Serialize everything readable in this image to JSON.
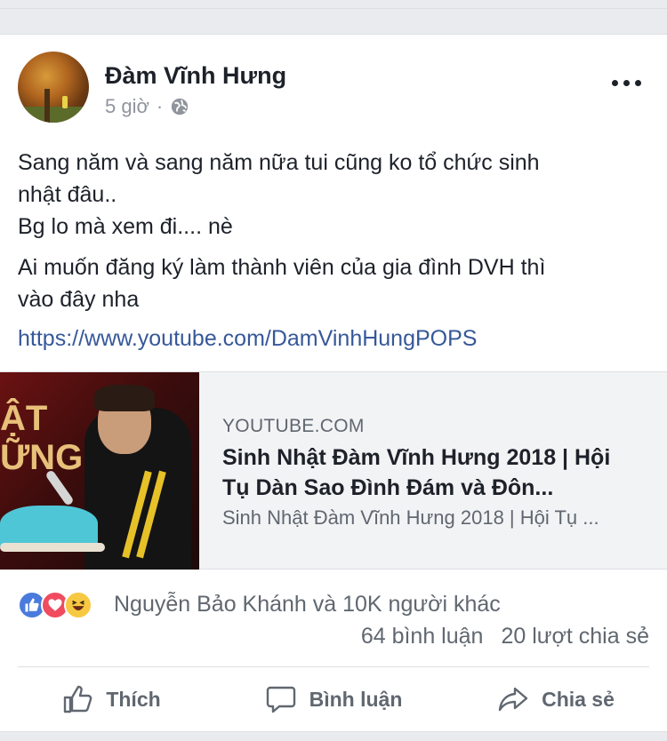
{
  "post": {
    "author": "Đàm Vĩnh Hưng",
    "time": "5 giờ",
    "separator": "·",
    "privacy_icon": "globe-icon",
    "more_icon": "more-options-icon",
    "text": {
      "paragraph1": "Sang năm và sang năm nữa tui cũng ko tổ chức sinh\nnhật đâu..\nBg lo mà xem đi.... nè",
      "paragraph2": "Ai muốn đăng ký làm thành viên của gia đình DVH thì\nvào đây nha"
    },
    "link": "https://www.youtube.com/DamVinhHungPOPS"
  },
  "preview": {
    "thumbnail_text": "ẬT\nỮNG",
    "domain": "YOUTUBE.COM",
    "title": "Sinh Nhật Đàm Vĩnh Hưng 2018 | Hội Tụ Dàn Sao Đình Đám và Đôn...",
    "description": "Sinh Nhật Đàm Vĩnh Hưng 2018 | Hội Tụ ..."
  },
  "engagement": {
    "reaction_icons": [
      "like-icon",
      "love-icon",
      "haha-icon"
    ],
    "reactors": "Nguyễn Bảo Khánh và 10K người khác",
    "comments": "64 bình luận",
    "shares": "20 lượt chia sẻ"
  },
  "actions": {
    "like": "Thích",
    "comment": "Bình luận",
    "share": "Chia sẻ"
  },
  "colors": {
    "link": "#365899",
    "like_blue": "#4a7bdc",
    "love_red": "#f04b5f",
    "haha_yellow": "#f7c842",
    "secondary_text": "#606770"
  }
}
